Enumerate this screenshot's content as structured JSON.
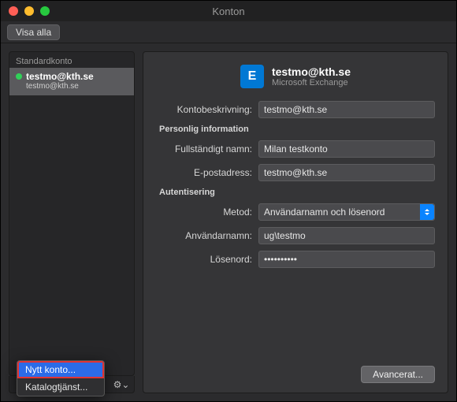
{
  "window": {
    "title": "Konton"
  },
  "toolbar": {
    "show_all": "Visa alla"
  },
  "sidebar": {
    "header": "Standardkonto",
    "account": {
      "name": "testmo@kth.se",
      "email": "testmo@kth.se"
    }
  },
  "content": {
    "header": {
      "title": "testmo@kth.se",
      "subtitle": "Microsoft Exchange"
    },
    "labels": {
      "description": "Kontobeskrivning:",
      "personal_section": "Personlig information",
      "fullname": "Fullständigt namn:",
      "email": "E-postadress:",
      "auth_section": "Autentisering",
      "method": "Metod:",
      "username": "Användarnamn:",
      "password": "Lösenord:"
    },
    "values": {
      "description": "testmo@kth.se",
      "fullname": "Milan testkonto",
      "email": "testmo@kth.se",
      "method": "Användarnamn och lösenord",
      "username": "ug\\testmo",
      "password": "••••••••••"
    },
    "advanced": "Avancerat..."
  },
  "popup": {
    "new_account": "Nytt konto...",
    "directory": "Katalogtjänst..."
  },
  "icons": {
    "exchange_letter": "E",
    "plus": "+",
    "minus": "−",
    "gear": "⚙",
    "gear_chev": "⌄"
  }
}
